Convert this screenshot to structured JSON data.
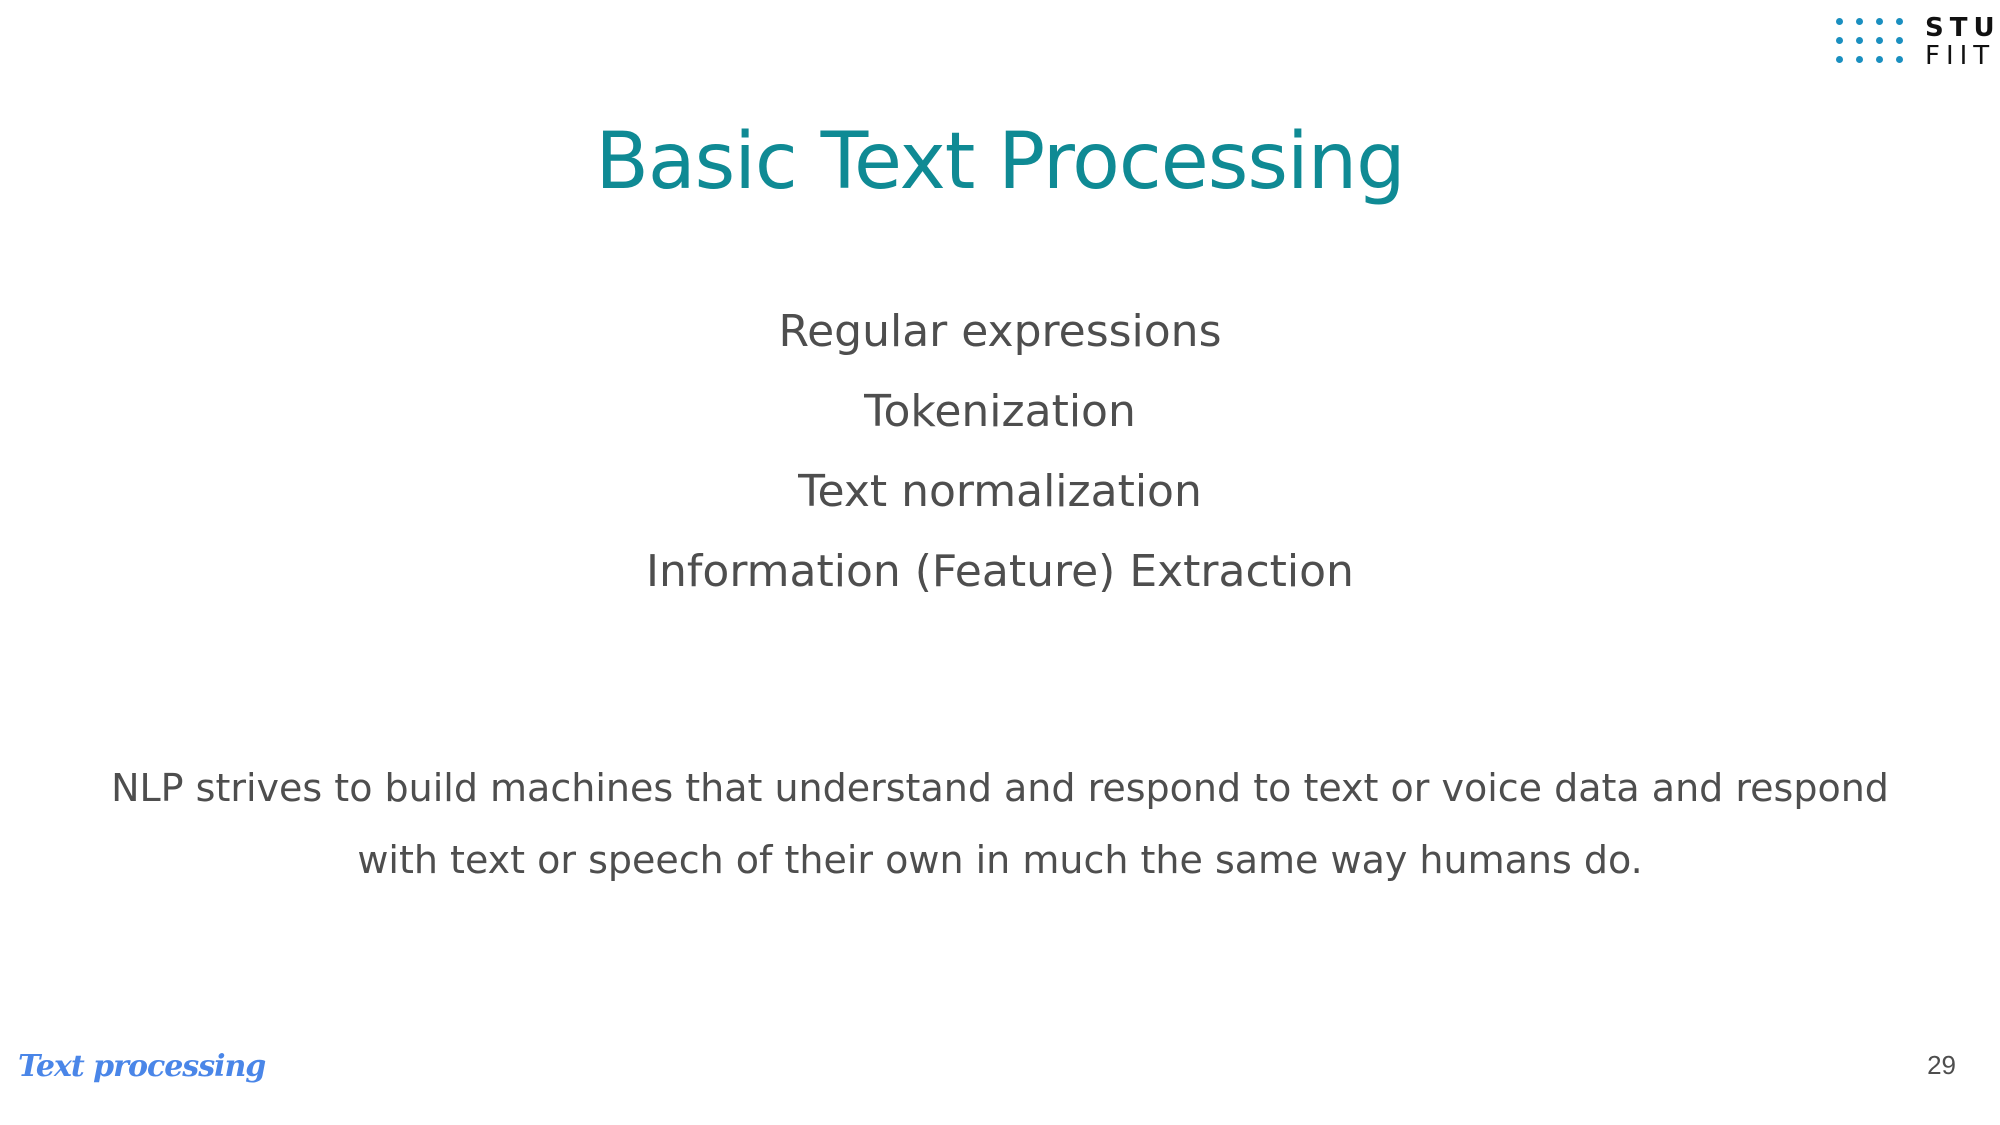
{
  "logo": {
    "line1": "STU",
    "line2": "FIIT",
    "dot_color": "#1a8fc0"
  },
  "title": "Basic Text Processing",
  "topics": [
    "Regular expressions",
    "Tokenization",
    "Text normalization",
    "Information (Feature) Extraction"
  ],
  "description": "NLP strives to build machines that understand and respond to text or voice data and respond with text or speech of their own in much the same way humans do.",
  "footer": {
    "label": "Text processing",
    "page_number": "29"
  },
  "colors": {
    "title": "#0f8a94",
    "body_text": "#4e4e4e",
    "footer_label": "#4a86e8"
  }
}
